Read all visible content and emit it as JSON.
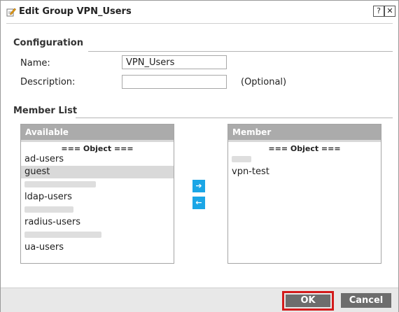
{
  "dialog": {
    "title": "Edit Group VPN_Users",
    "help_label": "?",
    "close_label": "✕"
  },
  "configuration": {
    "section_title": "Configuration",
    "name_label": "Name:",
    "name_value": "VPN_Users",
    "description_label": "Description:",
    "description_value": "",
    "description_hint": "(Optional)"
  },
  "member_list": {
    "section_title": "Member List",
    "available": {
      "header": "Available",
      "group_head": "=== Object ===",
      "items": [
        "ad-users",
        "guest",
        "",
        "ldap-users",
        "",
        "radius-users",
        "",
        "ua-users"
      ],
      "selected_index": 1
    },
    "member": {
      "header": "Member",
      "group_head": "=== Object ===",
      "items": [
        "",
        "vpn-test"
      ]
    },
    "add_arrow": "➔",
    "remove_arrow": "←"
  },
  "footer": {
    "ok_label": "OK",
    "cancel_label": "Cancel"
  },
  "colors": {
    "arrow_button": "#1ba6e6",
    "highlight_border": "#d31b1b",
    "footer_button": "#6d6d6d"
  }
}
